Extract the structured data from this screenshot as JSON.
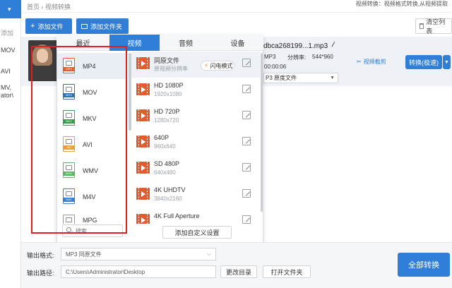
{
  "breadcrumb": {
    "home": "首页",
    "sep": "›",
    "current": "视频转换"
  },
  "top_hint": "视频转换：视频格式转换,从视频提取",
  "left_nav": {
    "collapse_label": "▾",
    "items": [
      "添加",
      "MOV",
      "AVI",
      "MV,",
      "ator\\"
    ]
  },
  "toolbar": {
    "add_file": "添加文件",
    "add_folder": "添加文件夹",
    "clear_list": "清空列表"
  },
  "file": {
    "name": "dbca268199...1.mp3",
    "format": "MP3",
    "resolution_label": "分辨率:",
    "resolution": "544*960",
    "duration": "00:00:06",
    "output_select": "P3  原度文件",
    "clip_label": "视频截剪",
    "convert_label": "转换(极速)"
  },
  "popup": {
    "tabs": [
      {
        "label": "最近",
        "active": false
      },
      {
        "label": "视频",
        "active": true
      },
      {
        "label": "音频",
        "active": false
      },
      {
        "label": "设备",
        "active": false
      }
    ],
    "formats": [
      {
        "label": "MP4",
        "color": "#e45b2e"
      },
      {
        "label": "MOV",
        "color": "#2f6fb8"
      },
      {
        "label": "MKV",
        "color": "#3a9a4a"
      },
      {
        "label": "AVI",
        "color": "#f0a030"
      },
      {
        "label": "WMV",
        "color": "#59b560"
      },
      {
        "label": "M4V",
        "color": "#3a7fd0"
      },
      {
        "label": "MPG",
        "color": "#7a5cc0"
      }
    ],
    "search_placeholder": "搜索",
    "qualities": [
      {
        "name": "同原文件",
        "sub": "原视频分辨率"
      },
      {
        "name": "HD 1080P",
        "sub": "1920x1080"
      },
      {
        "name": "HD 720P",
        "sub": "1280x720"
      },
      {
        "name": "640P",
        "sub": "960x640"
      },
      {
        "name": "SD 480P",
        "sub": "640x480"
      },
      {
        "name": "4K UHDTV",
        "sub": "3840x2160"
      },
      {
        "name": "4K Full Aperture",
        "sub": ""
      }
    ],
    "flash_mode": "闪电模式",
    "add_custom": "添加自定义设置"
  },
  "bottom": {
    "format_label": "输出格式:",
    "format_value": "MP3  同原文件",
    "path_label": "输出路径:",
    "path_value": "C:\\Users\\Administrator\\Desktop",
    "change_dir": "更改目录",
    "open_folder": "打开文件夹",
    "convert_all": "全部转换"
  },
  "colors": {
    "accent": "#2f7fd8",
    "highlight": "#e02020"
  }
}
